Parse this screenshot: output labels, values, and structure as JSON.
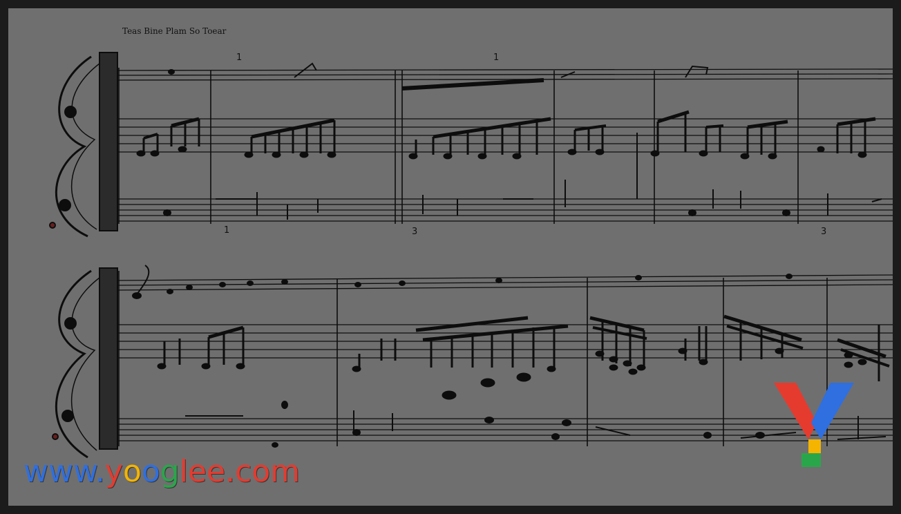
{
  "sheet": {
    "title": "Teas Bine Plam So Toear"
  },
  "measure_numbers": {
    "m1": "1",
    "m2": "1",
    "m3": "1",
    "m4": "3",
    "m5": "3"
  },
  "watermark": {
    "part1": "www.",
    "part2": "y",
    "part3": "o",
    "part4": "o",
    "part5": "g",
    "part6": "lee.com",
    "logo_icon": "yooglee-y-logo"
  },
  "colors": {
    "paper": "#6f6f6f",
    "ink": "#0d0d0d",
    "frame": "#1b1b1b"
  }
}
